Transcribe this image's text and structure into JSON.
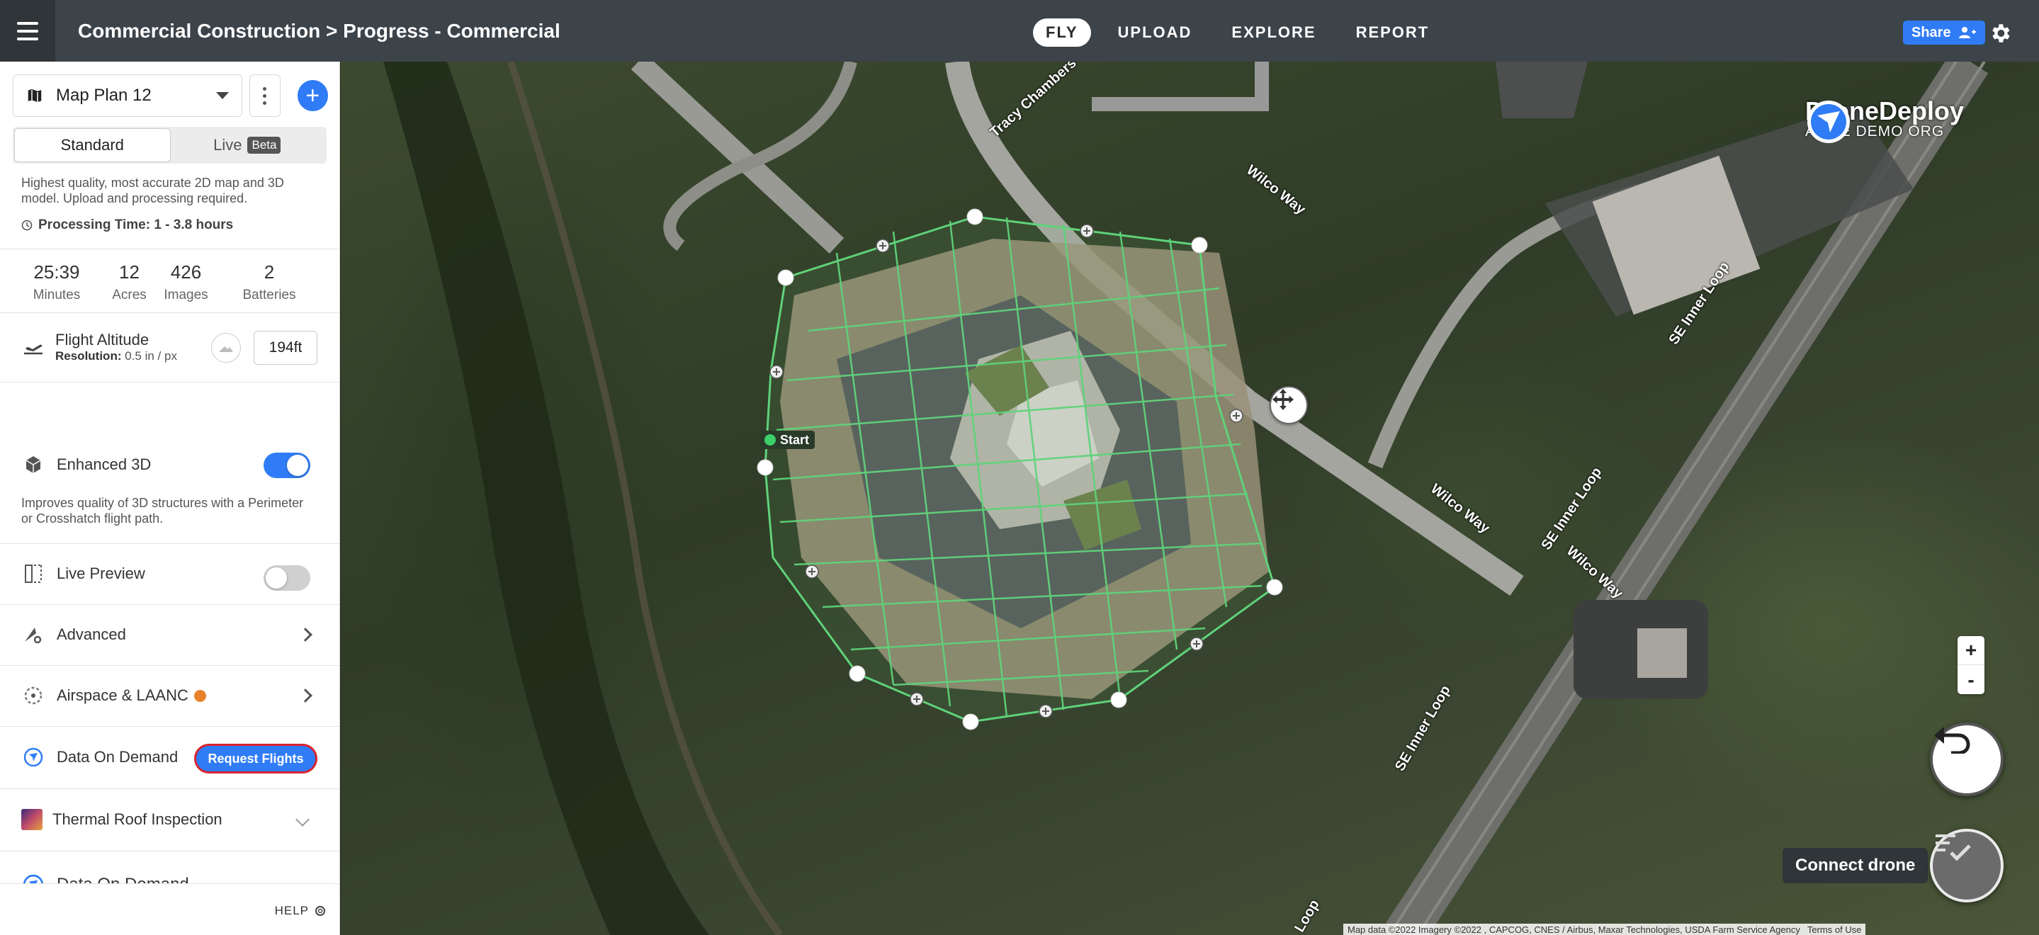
{
  "header": {
    "breadcrumb": "Commercial Construction > Progress - Commercial",
    "tabs": [
      {
        "label": "FLY",
        "active": true
      },
      {
        "label": "UPLOAD",
        "active": false
      },
      {
        "label": "EXPLORE",
        "active": false
      },
      {
        "label": "REPORT",
        "active": false
      }
    ],
    "share_label": "Share"
  },
  "sidebar": {
    "plan_name": "Map Plan 12",
    "mode": {
      "standard": "Standard",
      "live": "Live",
      "beta": "Beta"
    },
    "description": "Highest quality, most accurate 2D map and 3D model. Upload and processing required.",
    "processing_time": "Processing Time: 1 - 3.8 hours",
    "stats": [
      {
        "value": "25:39",
        "label": "Minutes"
      },
      {
        "value": "12",
        "label": "Acres"
      },
      {
        "value": "426",
        "label": "Images"
      },
      {
        "value": "2",
        "label": "Batteries"
      }
    ],
    "altitude": {
      "label": "Flight Altitude",
      "resolution_label": "Resolution:",
      "resolution_value": "0.5 in / px",
      "value": "194ft"
    },
    "enhanced3d": {
      "label": "Enhanced 3D",
      "enabled": true,
      "description": "Improves quality of 3D structures with a Perimeter or Crosshatch flight path."
    },
    "live_preview": {
      "label": "Live Preview",
      "enabled": false
    },
    "advanced": {
      "label": "Advanced"
    },
    "airspace": {
      "label": "Airspace & LAANC",
      "dot_color": "#e8822a"
    },
    "data_on_demand": {
      "label": "Data On Demand",
      "button": "Request Flights"
    },
    "thermal": {
      "label": "Thermal Roof Inspection"
    },
    "data_on_demand_2": {
      "label": "Data On Demand"
    },
    "help": "HELP"
  },
  "map": {
    "brand_name": "DroneDeploy",
    "brand_org": "ACME DEMO ORG",
    "start_label": "Start",
    "connect_label": "Connect drone",
    "zoom_in": "+",
    "zoom_out": "-",
    "attribution": "Map data ©2022 Imagery ©2022 , CAPCOG, CNES / Airbus, Maxar Technologies, USDA Farm Service Agency",
    "terms": "Terms of Use",
    "roads": {
      "wilco_top": "Wilco Way",
      "tracy": "Tracy Chambers",
      "wilco_mid": "Wilco Way",
      "wilco_right": "Wilco Way",
      "se_inner_top": "SE Inner Loop",
      "se_inner_mid": "SE Inner Loop",
      "se_inner_bot": "SE Inner Loop",
      "loop_bottom": "Loop"
    }
  },
  "colors": {
    "accent": "#2f7cf6",
    "header": "#3d4449",
    "flight_grid": "#5fd27a",
    "highlight": "#d8242c"
  }
}
